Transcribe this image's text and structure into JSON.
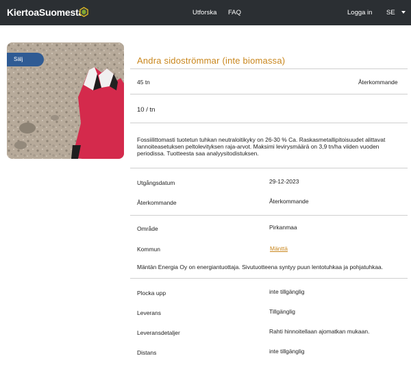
{
  "nav": {
    "brand": "KiertoaSuomesta",
    "explore": "Utforska",
    "faq": "FAQ",
    "login": "Logga in",
    "lang": "SE",
    "bg_color": "#2b2f33"
  },
  "listing": {
    "badge": "Sälj",
    "title": "Andra sidoströmmar (inte biomassa)",
    "amount": "45 tn",
    "frequency": "Återkommande",
    "price": "10 / tn",
    "description": "Fossiilittomasti tuotetun tuhkan neutraloitikyky on 26-30 % Ca. Raskasmetallipitoisuudet alittavat lannoiteasetuksen peltolevityksen raja-arvot. Maksimi levirysmäärä on 3,9 tn/ha viiden vuoden periodissa. Tuotteesta saa analyysitodistuksen.",
    "accent_color": "#c9861c"
  },
  "details": {
    "expiry_label": "Utgångsdatum",
    "expiry_value": "29-12-2023",
    "recurring_label": "Återkommande",
    "recurring_value": "Återkommande",
    "region_label": "Område",
    "region_value": "Pirkanmaa",
    "municipality_label": "Kommun",
    "municipality_value": "Mänttä",
    "company_text": "Mäntän Energia Oy on energiantuottaja. Sivutuotteena syntyy puun lentotuhkaa ja pohjatuhkaa.",
    "pickup_label": "Plocka upp",
    "pickup_value": "inte tillgänglig",
    "delivery_label": "Leverans",
    "delivery_value": "Tillgänglig",
    "delivery_details_label": "Leveransdetaljer",
    "delivery_details_value": "Rahti hinnoitellaan ajomatkan mukaan.",
    "distance_label": "Distans",
    "distance_value": "inte tillgänglig"
  }
}
